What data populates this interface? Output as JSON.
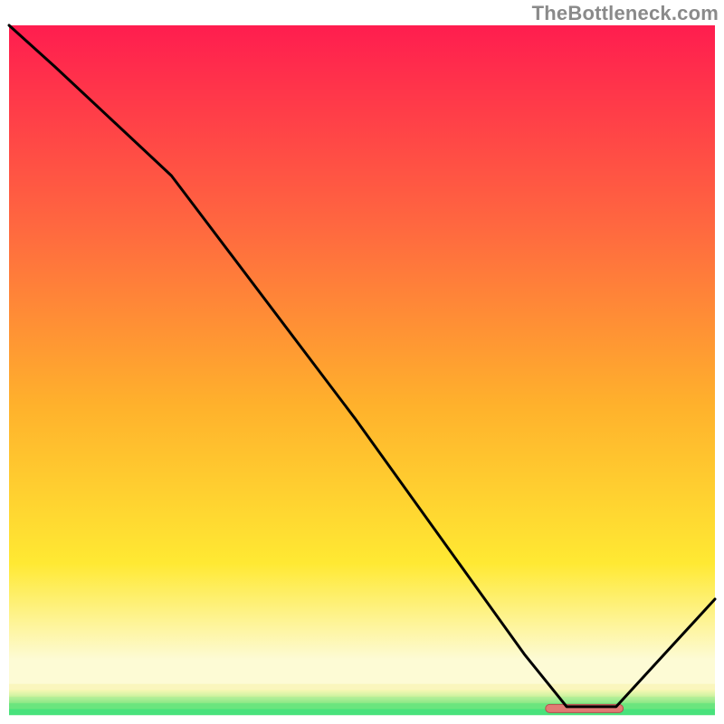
{
  "attribution": "TheBottleneck.com",
  "colors": {
    "top": "#ff1d4f",
    "mid_high": "#ff6a3f",
    "mid": "#ffb12c",
    "mid_low": "#ffe933",
    "cream": "#fdfbd5",
    "green": "#2de07a",
    "tick_fill": "#e17a74",
    "tick_stroke": "#b74f4d",
    "line": "#000000"
  },
  "chart_data": {
    "type": "line",
    "title": "",
    "xlabel": "",
    "ylabel": "",
    "xlim": [
      0,
      1
    ],
    "ylim": [
      0,
      1
    ],
    "series": [
      {
        "name": "curve",
        "x": [
          0.0,
          0.065,
          0.23,
          0.49,
          0.73,
          0.79,
          0.86,
          1.0
        ],
        "y": [
          1.0,
          0.94,
          0.782,
          0.43,
          0.088,
          0.012,
          0.012,
          0.168
        ]
      }
    ],
    "bottom_marker": {
      "x0": 0.76,
      "x1": 0.87,
      "y": 0.01
    }
  }
}
